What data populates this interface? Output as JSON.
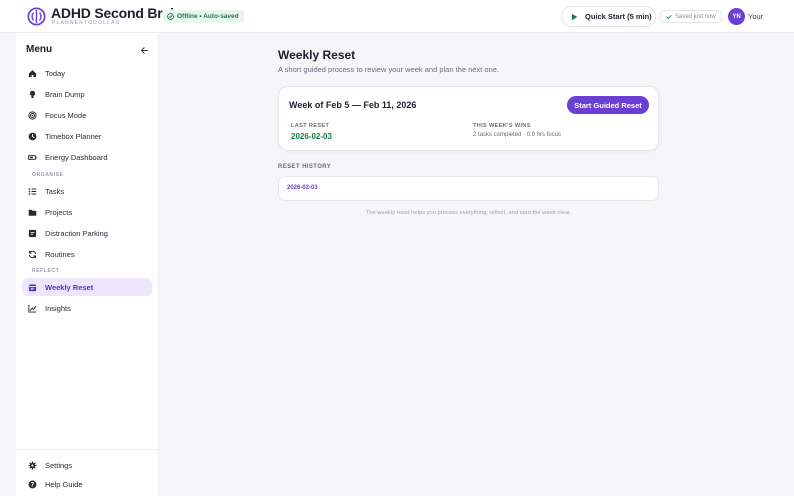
{
  "header": {
    "app_title": "ADHD Second Brain",
    "app_subtitle": "PLANNERTODOLLAS",
    "offline_status": "Offline • Auto-saved",
    "quick_start_label": "Quick Start (5 min)",
    "saved_status": "Saved just now",
    "avatar_initials": "YN",
    "user_name": "Your",
    "icons": [
      "brain-logo-icon",
      "check-circle-icon",
      "play-icon",
      "check-icon"
    ]
  },
  "sidebar": {
    "title": "Menu",
    "items": [
      {
        "label": "Today",
        "icon": "home-icon"
      },
      {
        "label": "Brain Dump",
        "icon": "lightbulb-icon"
      },
      {
        "label": "Focus Mode",
        "icon": "target-icon"
      },
      {
        "label": "Timebox Planner",
        "icon": "clock-icon"
      },
      {
        "label": "Energy Dashboard",
        "icon": "battery-icon"
      }
    ],
    "organise_label": "ORGANISE",
    "organise_items": [
      {
        "label": "Tasks",
        "icon": "checklist-icon"
      },
      {
        "label": "Projects",
        "icon": "folder-icon"
      },
      {
        "label": "Distraction Parking",
        "icon": "note-icon"
      },
      {
        "label": "Routines",
        "icon": "refresh-icon"
      }
    ],
    "reflect_label": "REFLECT",
    "reflect_items": [
      {
        "label": "Weekly Reset",
        "icon": "calendar-icon",
        "active": true
      },
      {
        "label": "Insights",
        "icon": "chart-line-icon"
      }
    ],
    "bottom_items": [
      {
        "label": "Settings",
        "icon": "gear-icon"
      },
      {
        "label": "Help Guide",
        "icon": "help-icon"
      }
    ]
  },
  "main": {
    "title": "Weekly Reset",
    "subtitle": "A short guided process to review your week and plan the next one.",
    "week_card": {
      "title": "Week of Feb 5 — Feb 11, 2026",
      "start_button": "Start Guided Reset",
      "last_reset_label": "LAST RESET",
      "last_reset_value": "2026-02-03",
      "wins_label": "THIS WEEK'S WINS",
      "wins_value": "2 tasks completed · 0.0 hrs focus"
    },
    "history_label": "RESET HISTORY",
    "history_items": [
      "2026-02-03"
    ],
    "footer_note": "The weekly reset helps you process everything, reflect, and start the week clear."
  },
  "colors": {
    "accent": "#6a3fd1",
    "active_bg": "#eee6fc",
    "success": "#1a7a4a",
    "success_bg": "#e8f6ee"
  }
}
